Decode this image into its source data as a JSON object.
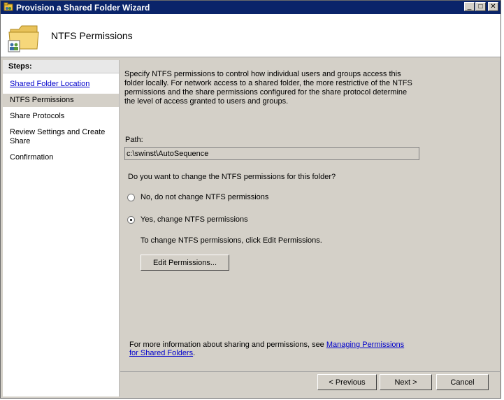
{
  "window": {
    "title": "Provision a Shared Folder Wizard"
  },
  "header": {
    "title": "NTFS Permissions"
  },
  "steps": {
    "heading": "Steps:",
    "items": [
      {
        "label": "Shared Folder Location"
      },
      {
        "label": "NTFS Permissions"
      },
      {
        "label": "Share Protocols"
      },
      {
        "label": "Review Settings and Create Share"
      },
      {
        "label": "Confirmation"
      }
    ]
  },
  "main": {
    "description": "Specify NTFS permissions to control how individual users and groups access this folder locally. For network access to a shared folder, the more restrictive of the NTFS permissions and the share permissions configured for the share protocol determine the level of access granted to users and groups.",
    "path_label": "Path:",
    "path_value": "c:\\swinst\\AutoSequence",
    "question": "Do you want to change the NTFS permissions for this folder?",
    "option_no": "No, do not change NTFS permissions",
    "option_yes": "Yes, change NTFS permissions",
    "selected_option": "yes",
    "hint": "To change NTFS permissions, click Edit Permissions.",
    "edit_button": "Edit Permissions...",
    "footer_prefix": "For more information about sharing and permissions, see ",
    "footer_link": "Managing Permissions for Shared Folders",
    "footer_suffix": "."
  },
  "buttons": {
    "previous": "< Previous",
    "next": "Next >",
    "cancel": "Cancel"
  }
}
